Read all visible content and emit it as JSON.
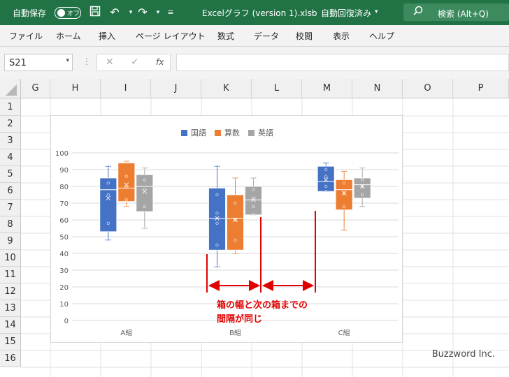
{
  "titlebar": {
    "autosave_label": "自動保存",
    "autosave_toggle": "オフ",
    "filename": "Excelグラフ (version 1).xlsb",
    "separator": "-",
    "save_status": "自動回復済み",
    "search_placeholder": "検索 (Alt+Q)"
  },
  "ribbon": {
    "tabs": [
      {
        "label": "ファイル"
      },
      {
        "label": "ホーム"
      },
      {
        "label": "挿入"
      },
      {
        "label": "ページ レイアウト"
      },
      {
        "label": "数式"
      },
      {
        "label": "データ"
      },
      {
        "label": "校閲"
      },
      {
        "label": "表示"
      },
      {
        "label": "ヘルプ"
      }
    ]
  },
  "formula_bar": {
    "name_box": "S21",
    "fx": "fx",
    "value": ""
  },
  "sheet": {
    "columns": [
      "G",
      "H",
      "I",
      "J",
      "K",
      "L",
      "M",
      "N",
      "O",
      "P"
    ],
    "rows": [
      "1",
      "2",
      "3",
      "4",
      "5",
      "6",
      "7",
      "8",
      "9",
      "10",
      "11",
      "12",
      "13",
      "14",
      "15",
      "16"
    ]
  },
  "chart_data": {
    "type": "boxplot",
    "categories": [
      "A組",
      "B組",
      "C組"
    ],
    "series": [
      {
        "name": "国語",
        "color": "#4472c4",
        "boxes": [
          {
            "min": 48,
            "q1": 53,
            "median": 78,
            "q3": 85,
            "max": 92,
            "mean": 73,
            "points": [
              48,
              58,
              75,
              82,
              92
            ]
          },
          {
            "min": 32,
            "q1": 42,
            "median": 61,
            "q3": 79,
            "max": 92,
            "mean": 61,
            "points": [
              32,
              45,
              58,
              64,
              75,
              92
            ]
          },
          {
            "min": 77,
            "q1": 77,
            "median": 83,
            "q3": 92,
            "max": 94,
            "mean": 84,
            "points": [
              77,
              80,
              86,
              90,
              94
            ]
          }
        ]
      },
      {
        "name": "算数",
        "color": "#ed7d31",
        "boxes": [
          {
            "min": 68,
            "q1": 71,
            "median": 79,
            "q3": 94,
            "max": 95,
            "mean": 81,
            "points": [
              68,
              72,
              80,
              86,
              95
            ]
          },
          {
            "min": 40,
            "q1": 42,
            "median": 61,
            "q3": 75,
            "max": 85,
            "mean": 60,
            "points": [
              40,
              48,
              60,
              70,
              85
            ]
          },
          {
            "min": 54,
            "q1": 66,
            "median": 78,
            "q3": 84,
            "max": 89,
            "mean": 76,
            "points": [
              54,
              68,
              76,
              82,
              89
            ]
          }
        ]
      },
      {
        "name": "英語",
        "color": "#a5a5a5",
        "boxes": [
          {
            "min": 55,
            "q1": 65,
            "median": 80,
            "q3": 87,
            "max": 91,
            "mean": 77,
            "points": [
              55,
              68,
              78,
              84,
              91
            ]
          },
          {
            "min": 63,
            "q1": 63,
            "median": 72,
            "q3": 80,
            "max": 85,
            "mean": 72,
            "points": [
              63,
              68,
              73,
              78,
              85
            ]
          },
          {
            "min": 68,
            "q1": 73,
            "median": 81,
            "q3": 85,
            "max": 91,
            "mean": 80,
            "points": [
              68,
              75,
              80,
              84,
              91
            ]
          }
        ]
      }
    ],
    "yticks": [
      0,
      10,
      20,
      30,
      40,
      50,
      60,
      70,
      80,
      90,
      100
    ],
    "ylim": [
      0,
      100
    ],
    "legend_position": "top",
    "gridlines": true
  },
  "annotation": {
    "line1": "箱の幅と次の箱までの",
    "line2": "間隔が同じ",
    "color": "#e00000"
  },
  "watermark": "Buzzword Inc."
}
